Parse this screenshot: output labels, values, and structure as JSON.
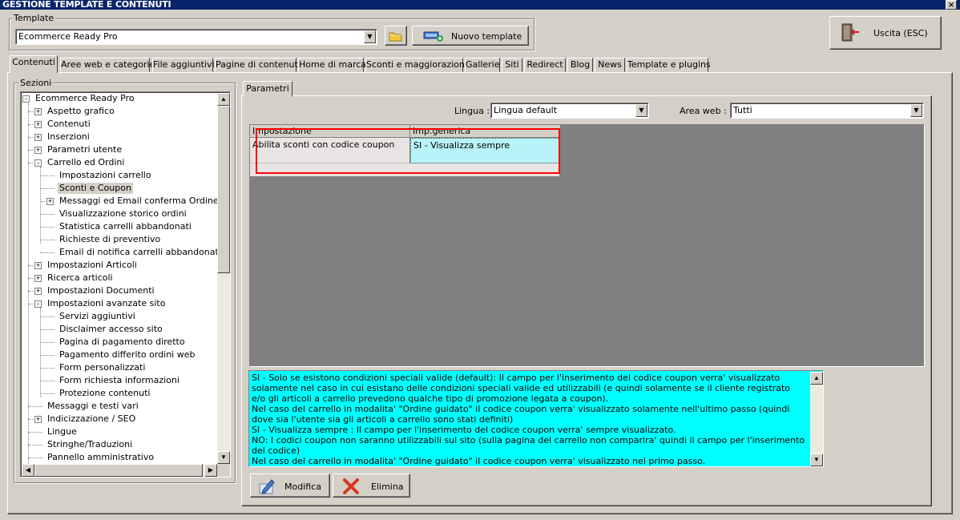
{
  "window": {
    "title": "GESTIONE TEMPLATE E CONTENUTI",
    "close": "×"
  },
  "template": {
    "group_label": "Template",
    "selected": "Ecommerce Ready Pro",
    "new_button": "Nuovo template"
  },
  "exit_button": "Uscita (ESC)",
  "tabs": [
    {
      "label": "Contenuti",
      "active": true
    },
    {
      "label": "Aree web e categorie"
    },
    {
      "label": "File aggiuntivi"
    },
    {
      "label": "Pagine di contenuti"
    },
    {
      "label": "Home di marca"
    },
    {
      "label": "Sconti e maggiorazioni"
    },
    {
      "label": "Gallerie"
    },
    {
      "label": "Siti"
    },
    {
      "label": "Redirect"
    },
    {
      "label": "Blog"
    },
    {
      "label": "News"
    },
    {
      "label": "Template e plugins"
    }
  ],
  "sections": {
    "group_label": "Sezioni",
    "tree": [
      {
        "label": "Ecommerce Ready Pro",
        "level": 0,
        "exp": "-"
      },
      {
        "label": "Aspetto grafico",
        "level": 1,
        "exp": "+"
      },
      {
        "label": "Contenuti",
        "level": 1,
        "exp": "+"
      },
      {
        "label": "Inserzioni",
        "level": 1,
        "exp": "+"
      },
      {
        "label": "Parametri utente",
        "level": 1,
        "exp": "+"
      },
      {
        "label": "Carrello ed Ordini",
        "level": 1,
        "exp": "-"
      },
      {
        "label": "Impostazioni carrello",
        "level": 2
      },
      {
        "label": "Sconti e Coupon",
        "level": 2,
        "selected": true
      },
      {
        "label": "Messaggi ed Email conferma Ordine",
        "level": 2,
        "exp": "+"
      },
      {
        "label": "Visualizzazione storico ordini",
        "level": 2
      },
      {
        "label": "Statistica carrelli abbandonati",
        "level": 2
      },
      {
        "label": "Richieste di preventivo",
        "level": 2
      },
      {
        "label": "Email di notifica carrelli abbandonati",
        "level": 2
      },
      {
        "label": "Impostazioni Articoli",
        "level": 1,
        "exp": "+"
      },
      {
        "label": "Ricerca articoli",
        "level": 1,
        "exp": "+"
      },
      {
        "label": "Impostazioni Documenti",
        "level": 1,
        "exp": "+"
      },
      {
        "label": "Impostazioni avanzate sito",
        "level": 1,
        "exp": "-"
      },
      {
        "label": "Servizi aggiuntivi",
        "level": 2
      },
      {
        "label": "Disclaimer accesso sito",
        "level": 2
      },
      {
        "label": "Pagina di pagamento diretto",
        "level": 2
      },
      {
        "label": "Pagamento differito ordini web",
        "level": 2
      },
      {
        "label": "Form personalizzati",
        "level": 2
      },
      {
        "label": "Form richiesta informazioni",
        "level": 2
      },
      {
        "label": "Protezione contenuti",
        "level": 2
      },
      {
        "label": "Messaggi e testi vari",
        "level": 1
      },
      {
        "label": "Indicizzazione / SEO",
        "level": 1,
        "exp": "+"
      },
      {
        "label": "Lingue",
        "level": 1
      },
      {
        "label": "Stringhe/Traduzioni",
        "level": 1
      },
      {
        "label": "Pannello amministrativo",
        "level": 1
      }
    ]
  },
  "params": {
    "tab_label": "Parametri",
    "lingua_label": "Lingua :",
    "lingua_value": "Lingua default",
    "area_label": "Area web :",
    "area_value": "Tutti",
    "grid": {
      "headers": [
        "Impostazione",
        "Imp.generica"
      ],
      "rows": [
        [
          "Abilita sconti con codice coupon",
          "SI - Visualizza sempre"
        ]
      ]
    },
    "help_text": "SI - Solo se esistono condizioni speciali valide (default): Il campo per l'inserimento del codice coupon verra' visualizzato solamente nel caso in cui esistano delle condizioni speciali valide ed utilizzabili (e quindi solamente se il cliente registrato e/o gli articoli a carrello prevedono qualche tipo di promozione legata a coupon).\nNel caso del carrello in modalita' \"Ordine guidato\" il codice coupon verra' visualizzato solamente nell'ultimo passo (quindi dove sia l'utente sia gli articoli a carrello sono stati definiti)\nSI - Visualizza sempre : Il campo per l'inserimento del codice coupon verra' sempre visualizzato.\nNO: I codici coupon non saranno utilizzabili sul sito (sulla pagina del carrello non comparira' quindi il campo per l'inserimento del codice)\nNel caso del carrello in modalita' \"Ordine guidato\" il codice coupon verra' visualizzato nel primo passo.",
    "modify_button": "Modifica",
    "delete_button": "Elimina"
  },
  "colors": {
    "titlebar": "#0a246a",
    "grid_bg": "#808080",
    "highlight": "#00ffff",
    "annotation": "#ff0000"
  }
}
